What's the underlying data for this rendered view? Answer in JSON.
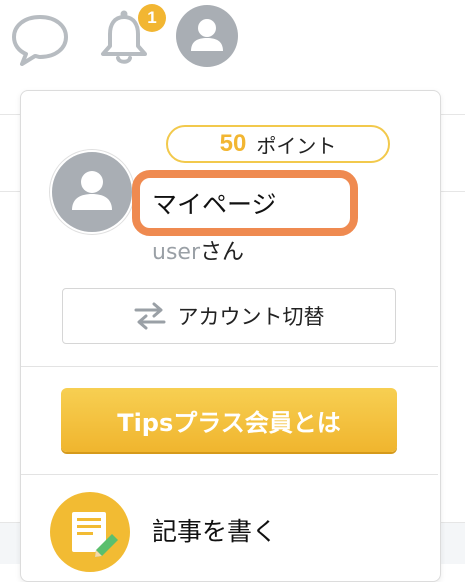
{
  "header": {
    "notification_count": "1",
    "icons": [
      "chat-bubble-icon",
      "bell-icon",
      "user-avatar"
    ]
  },
  "menu": {
    "points_value": "50",
    "points_unit": "ポイント",
    "mypage_label": "マイページ",
    "username": "user",
    "username_suffix": "さん",
    "switch_account_label": "アカウント切替",
    "premium_label": "Tipsプラス会員とは",
    "write_article_label": "記事を書く"
  },
  "colors": {
    "accent_yellow": "#f2b632",
    "highlight_orange": "#ef8a50",
    "avatar_gray": "#a9aeb4"
  }
}
